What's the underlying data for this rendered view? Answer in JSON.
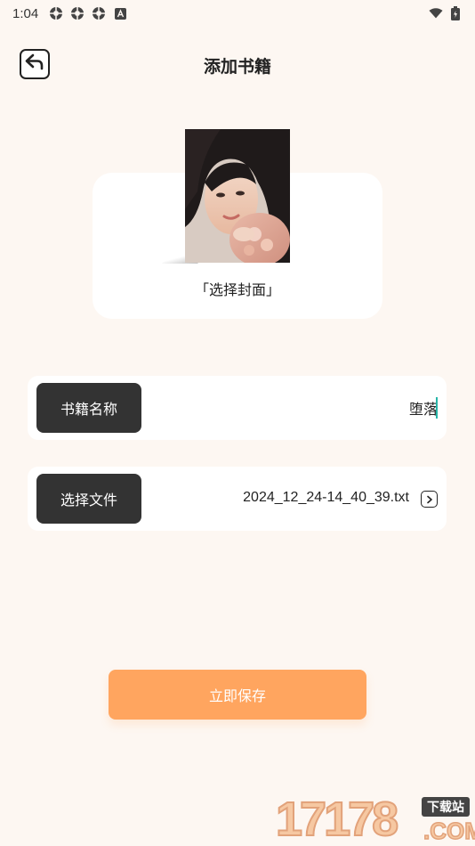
{
  "status_bar": {
    "time": "1:04",
    "left_icons": [
      "app-icon",
      "app-icon",
      "app-icon",
      "a-badge-icon"
    ],
    "right_icons": [
      "wifi-icon",
      "battery-icon"
    ]
  },
  "header": {
    "title": "添加书籍",
    "back_icon": "back-arrow-icon"
  },
  "cover": {
    "label": "「选择封面」"
  },
  "form": {
    "name_label": "书籍名称",
    "name_value": "堕落",
    "file_label": "选择文件",
    "file_value": "2024_12_24-14_40_39.txt",
    "file_icon": "chevron-right-icon"
  },
  "actions": {
    "save_label": "立即保存"
  },
  "watermark": {
    "digits": "17178",
    "tag": "下载站",
    "suffix": ".COM"
  },
  "colors": {
    "background": "#fdf7f2",
    "accent": "#ffa55f",
    "label_bg": "#333333",
    "caret": "#26b5a8"
  }
}
